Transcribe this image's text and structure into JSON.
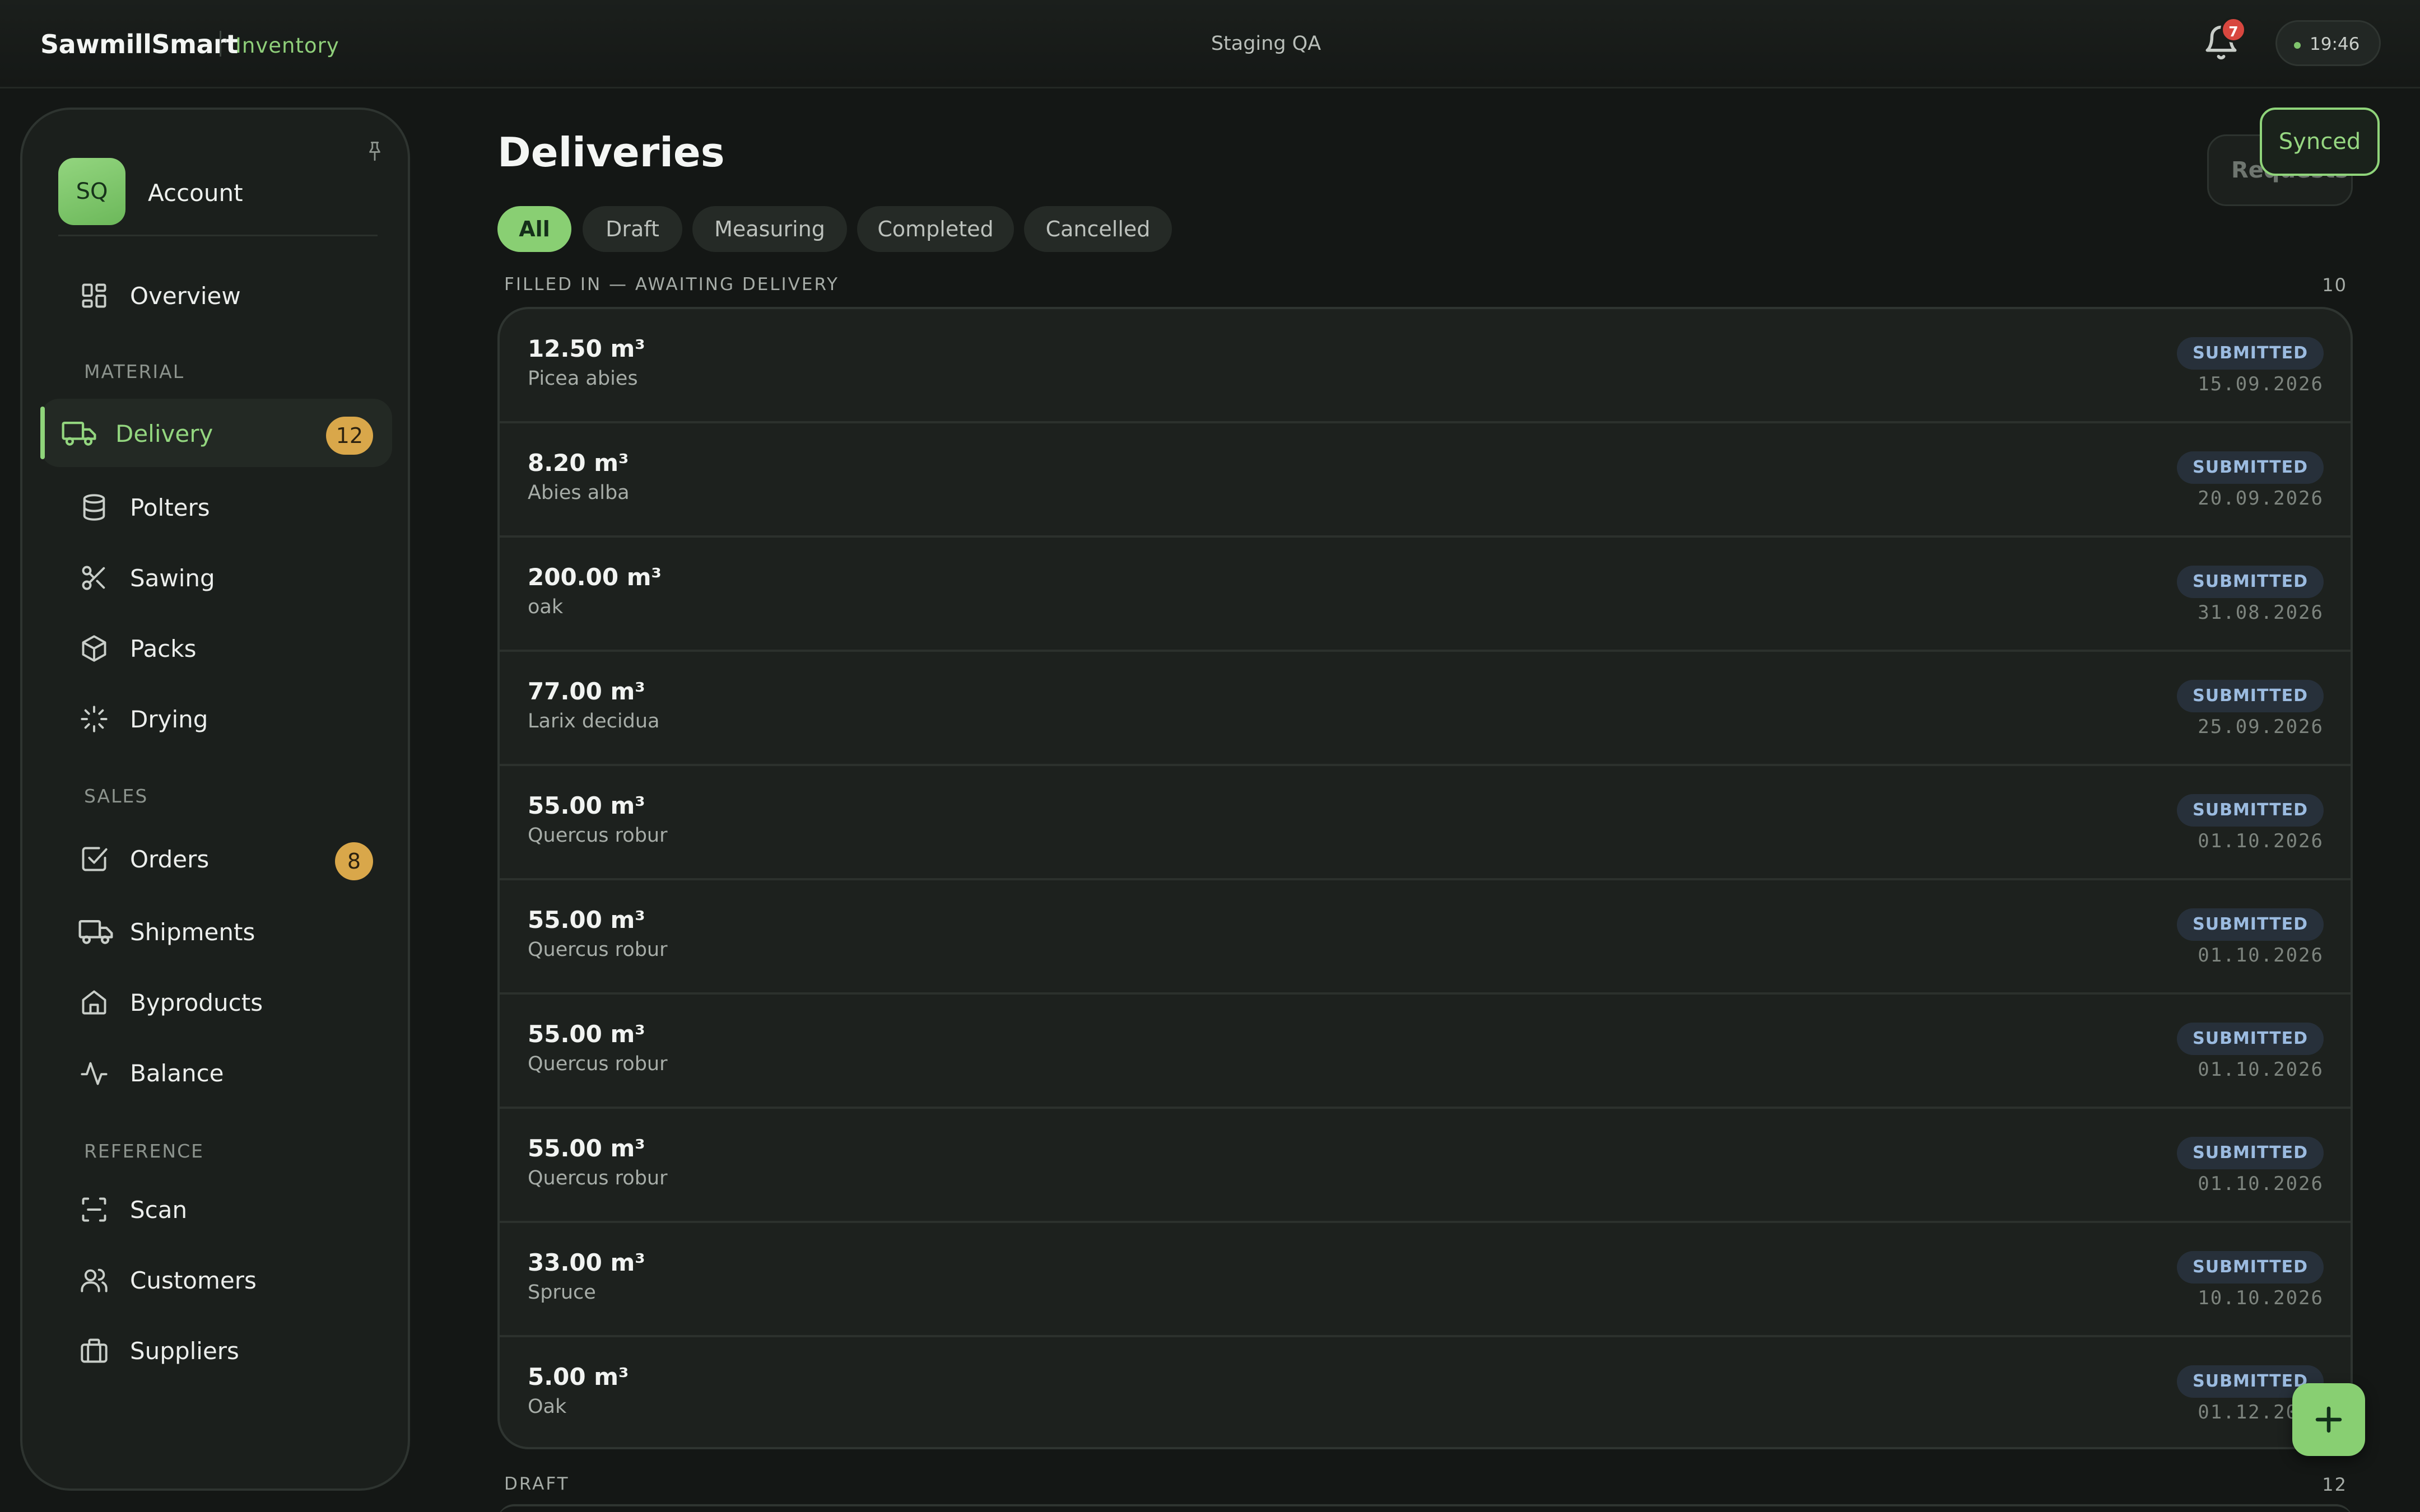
{
  "header": {
    "brand": "SawmillSmart",
    "module": "Inventory",
    "environment": "Staging QA",
    "notification_count": "7",
    "time": "19:46"
  },
  "sidebar": {
    "account": {
      "initials": "SQ",
      "label": "Account"
    },
    "overview": "Overview",
    "sections": [
      {
        "title": "MATERIAL",
        "items": [
          {
            "label": "Delivery",
            "count": "12",
            "icon": "truck-icon",
            "active": true
          },
          {
            "label": "Polters",
            "icon": "database-icon"
          },
          {
            "label": "Sawing",
            "icon": "scissors-icon"
          },
          {
            "label": "Packs",
            "icon": "box-icon"
          },
          {
            "label": "Drying",
            "icon": "loader-icon"
          }
        ]
      },
      {
        "title": "SALES",
        "items": [
          {
            "label": "Orders",
            "count": "8",
            "icon": "checkbox-icon"
          },
          {
            "label": "Shipments",
            "icon": "truck-icon"
          },
          {
            "label": "Byproducts",
            "icon": "home-icon"
          },
          {
            "label": "Balance",
            "icon": "activity-icon"
          }
        ]
      },
      {
        "title": "REFERENCE",
        "items": [
          {
            "label": "Scan",
            "icon": "scan-icon"
          },
          {
            "label": "Customers",
            "icon": "users-icon"
          },
          {
            "label": "Suppliers",
            "icon": "briefcase-icon"
          }
        ]
      }
    ]
  },
  "main": {
    "title": "Deliveries",
    "requests_label": "Requests",
    "sync_status": "Synced",
    "tabs": [
      "All",
      "Draft",
      "Measuring",
      "Completed",
      "Cancelled"
    ],
    "active_tab": "All",
    "groups": [
      {
        "title": "FILLED IN — AWAITING DELIVERY",
        "count": "10",
        "rows": [
          {
            "volume": "12.50 m³",
            "species": "Picea abies",
            "status": "SUBMITTED",
            "date": "15.09.2026"
          },
          {
            "volume": "8.20 m³",
            "species": "Abies alba",
            "status": "SUBMITTED",
            "date": "20.09.2026"
          },
          {
            "volume": "200.00 m³",
            "species": "oak",
            "status": "SUBMITTED",
            "date": "31.08.2026"
          },
          {
            "volume": "77.00 m³",
            "species": "Larix decidua",
            "status": "SUBMITTED",
            "date": "25.09.2026"
          },
          {
            "volume": "55.00 m³",
            "species": "Quercus robur",
            "status": "SUBMITTED",
            "date": "01.10.2026"
          },
          {
            "volume": "55.00 m³",
            "species": "Quercus robur",
            "status": "SUBMITTED",
            "date": "01.10.2026"
          },
          {
            "volume": "55.00 m³",
            "species": "Quercus robur",
            "status": "SUBMITTED",
            "date": "01.10.2026"
          },
          {
            "volume": "55.00 m³",
            "species": "Quercus robur",
            "status": "SUBMITTED",
            "date": "01.10.2026"
          },
          {
            "volume": "33.00 m³",
            "species": "Spruce",
            "status": "SUBMITTED",
            "date": "10.10.2026"
          },
          {
            "volume": "5.00 m³",
            "species": "Oak",
            "status": "SUBMITTED",
            "date": "01.12.2026"
          }
        ]
      },
      {
        "title": "DRAFT",
        "count": "12",
        "rows": []
      }
    ]
  },
  "colors": {
    "accent": "#8fd47a",
    "badge_count": "#d9a74a",
    "status_chip": "#27303a",
    "notification": "#d8473f"
  }
}
